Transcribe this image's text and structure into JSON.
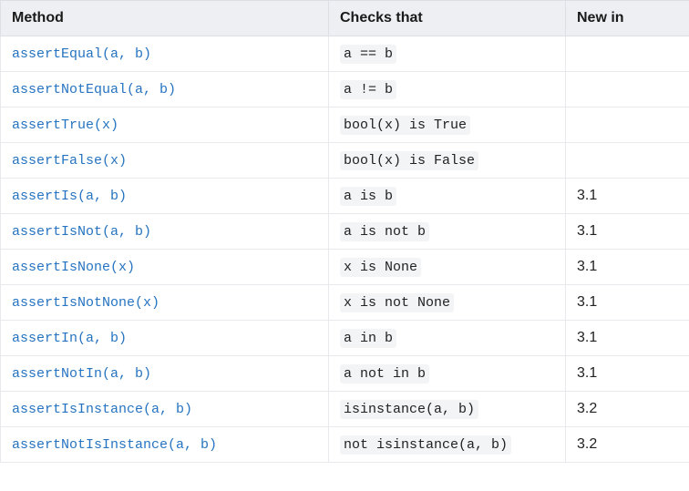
{
  "table": {
    "headers": {
      "method": "Method",
      "checks": "Checks that",
      "new_in": "New in"
    },
    "rows": [
      {
        "method": "assertEqual(a, b)",
        "check": "a == b",
        "new_in": ""
      },
      {
        "method": "assertNotEqual(a, b)",
        "check": "a != b",
        "new_in": ""
      },
      {
        "method": "assertTrue(x)",
        "check": "bool(x) is True",
        "new_in": ""
      },
      {
        "method": "assertFalse(x)",
        "check": "bool(x) is False",
        "new_in": ""
      },
      {
        "method": "assertIs(a, b)",
        "check": "a is b",
        "new_in": "3.1"
      },
      {
        "method": "assertIsNot(a, b)",
        "check": "a is not b",
        "new_in": "3.1"
      },
      {
        "method": "assertIsNone(x)",
        "check": "x is None",
        "new_in": "3.1"
      },
      {
        "method": "assertIsNotNone(x)",
        "check": "x is not None",
        "new_in": "3.1"
      },
      {
        "method": "assertIn(a, b)",
        "check": "a in b",
        "new_in": "3.1"
      },
      {
        "method": "assertNotIn(a, b)",
        "check": "a not in b",
        "new_in": "3.1"
      },
      {
        "method": "assertIsInstance(a, b)",
        "check": "isinstance(a, b)",
        "new_in": "3.2"
      },
      {
        "method": "assertNotIsInstance(a, b)",
        "check": "not isinstance(a, b)",
        "new_in": "3.2"
      }
    ]
  }
}
